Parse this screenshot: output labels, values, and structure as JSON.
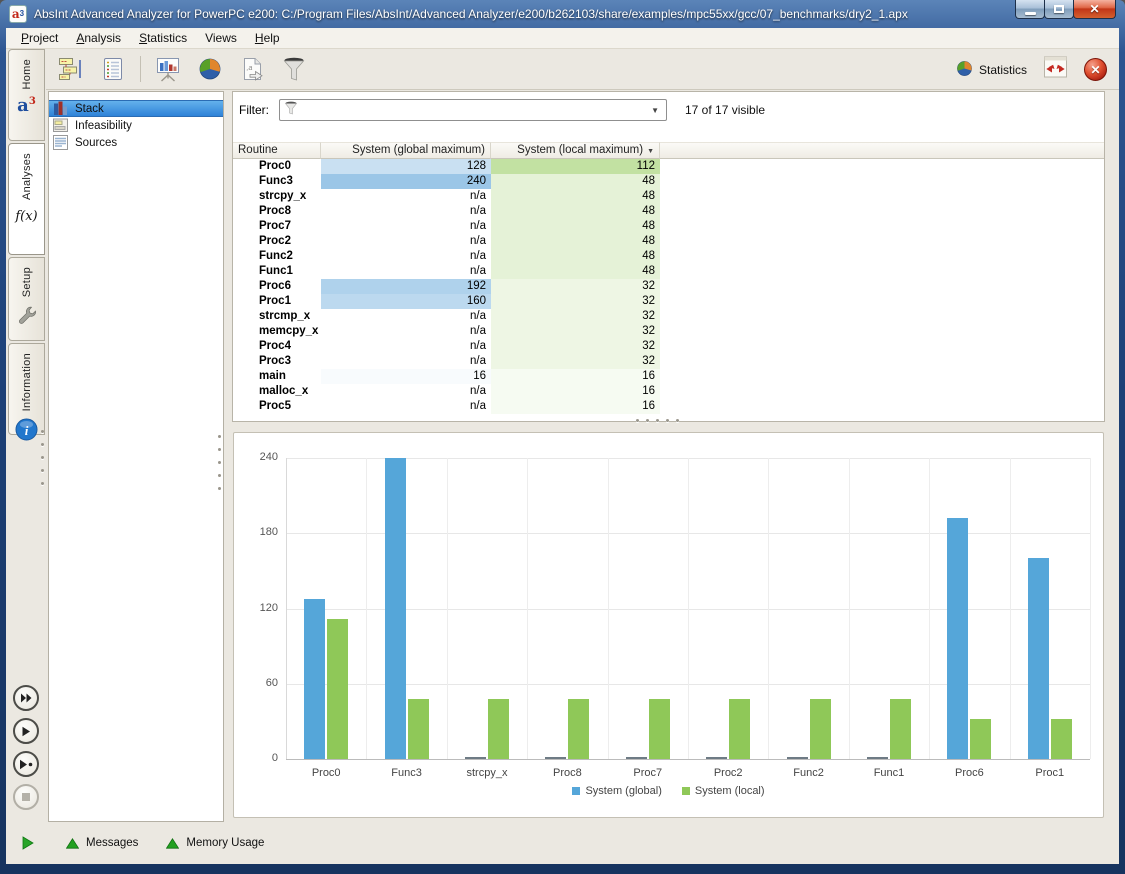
{
  "window": {
    "title": "AbsInt Advanced Analyzer for PowerPC e200: C:/Program Files/AbsInt/Advanced Analyzer/e200/b262103/share/examples/mpc55xx/gcc/07_benchmarks/dry2_1.apx"
  },
  "menu": {
    "items": [
      {
        "label": "Project",
        "underline": 0
      },
      {
        "label": "Analysis",
        "underline": 0
      },
      {
        "label": "Statistics",
        "underline": 0
      },
      {
        "label": "Views",
        "underline": -1
      },
      {
        "label": "Help",
        "underline": 0
      }
    ]
  },
  "toolbar": {
    "groups": [
      [
        {
          "icon": "call-graph-icon"
        },
        {
          "icon": "report-icon"
        }
      ],
      [
        {
          "icon": "bar-chart-icon"
        },
        {
          "icon": "pie-chart-icon"
        },
        {
          "icon": "export-icon"
        },
        {
          "icon": "filter-funnel-icon"
        }
      ]
    ],
    "right": {
      "statistics_label": "Statistics",
      "statistics_icon": "pie-small-icon",
      "expand_icon": "expand-icon"
    }
  },
  "sidebar": {
    "tabs": [
      {
        "label": "Home",
        "icon": "absint-logo-icon",
        "selected": false
      },
      {
        "label": "Analyses",
        "icon": "fx-icon",
        "icon_text": "f(x)",
        "selected": true
      },
      {
        "label": "Setup",
        "icon": "wrench-icon",
        "selected": false
      },
      {
        "label": "Information",
        "icon": "info-icon",
        "selected": false
      }
    ],
    "run_buttons": [
      {
        "name": "run-all-button",
        "icon": "fast-forward-icon",
        "enabled": true
      },
      {
        "name": "run-button",
        "icon": "play-icon",
        "enabled": true
      },
      {
        "name": "run-to-point-button",
        "icon": "play-dot-icon",
        "enabled": true
      },
      {
        "name": "stop-button",
        "icon": "stop-icon",
        "enabled": false
      }
    ]
  },
  "analyses_panel": {
    "items": [
      {
        "label": "Stack",
        "icon": "stack-chart-icon",
        "selected": true
      },
      {
        "label": "Infeasibility",
        "icon": "infeasibility-icon",
        "selected": false
      },
      {
        "label": "Sources",
        "icon": "sources-icon",
        "selected": false
      }
    ]
  },
  "filter": {
    "label": "Filter:",
    "value": "",
    "count": "17 of 17 visible"
  },
  "table": {
    "columns": [
      {
        "label": "Routine",
        "align": "left"
      },
      {
        "label": "System (global maximum)",
        "align": "right"
      },
      {
        "label": "System (local maximum)",
        "align": "right",
        "sorted": "desc"
      }
    ],
    "rows": [
      {
        "routine": "Proc0",
        "global": "128",
        "local": "112"
      },
      {
        "routine": "Func3",
        "global": "240",
        "local": "48"
      },
      {
        "routine": "strcpy_x",
        "global": "n/a",
        "local": "48"
      },
      {
        "routine": "Proc8",
        "global": "n/a",
        "local": "48"
      },
      {
        "routine": "Proc7",
        "global": "n/a",
        "local": "48"
      },
      {
        "routine": "Proc2",
        "global": "n/a",
        "local": "48"
      },
      {
        "routine": "Func2",
        "global": "n/a",
        "local": "48"
      },
      {
        "routine": "Func1",
        "global": "n/a",
        "local": "48"
      },
      {
        "routine": "Proc6",
        "global": "192",
        "local": "32"
      },
      {
        "routine": "Proc1",
        "global": "160",
        "local": "32"
      },
      {
        "routine": "strcmp_x",
        "global": "n/a",
        "local": "32"
      },
      {
        "routine": "memcpy_x",
        "global": "n/a",
        "local": "32"
      },
      {
        "routine": "Proc4",
        "global": "n/a",
        "local": "32"
      },
      {
        "routine": "Proc3",
        "global": "n/a",
        "local": "32"
      },
      {
        "routine": "main",
        "global": "16",
        "local": "16"
      },
      {
        "routine": "malloc_x",
        "global": "n/a",
        "local": "16"
      },
      {
        "routine": "Proc5",
        "global": "n/a",
        "local": "16"
      }
    ],
    "max": {
      "global": 240,
      "local": 112
    },
    "fill_colors": {
      "global": "88,160,215",
      "local": "139,197,77"
    }
  },
  "chart_data": {
    "type": "bar",
    "title": "",
    "categories": [
      "Proc0",
      "Func3",
      "strcpy_x",
      "Proc8",
      "Proc7",
      "Proc2",
      "Func2",
      "Func1",
      "Proc6",
      "Proc1"
    ],
    "series": [
      {
        "name": "System (global)",
        "color": "#55a6d9",
        "values": [
          128,
          240,
          null,
          null,
          null,
          null,
          null,
          null,
          192,
          160
        ]
      },
      {
        "name": "System (local)",
        "color": "#8fc858",
        "values": [
          112,
          48,
          48,
          48,
          48,
          48,
          48,
          48,
          32,
          32
        ]
      }
    ],
    "ylim": [
      0,
      240
    ],
    "yticks": [
      0,
      60,
      120,
      180,
      240
    ],
    "grid": true,
    "legend_position": "bottom"
  },
  "statusbar": {
    "buttons": [
      {
        "label": "Messages",
        "icon": "up-triangle-icon"
      },
      {
        "label": "Memory Usage",
        "icon": "up-triangle-icon"
      }
    ]
  }
}
